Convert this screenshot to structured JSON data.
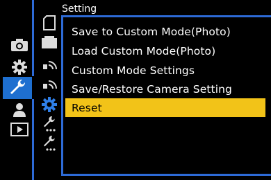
{
  "header": {
    "title": "Setting"
  },
  "main_tabs": [
    {
      "icon": "camera-icon",
      "label": "Photo"
    },
    {
      "icon": "gear-icon",
      "label": "Custom"
    },
    {
      "icon": "wrench-icon",
      "label": "Setup"
    },
    {
      "icon": "person-icon",
      "label": "My Menu"
    },
    {
      "icon": "playback-icon",
      "label": "Playback"
    }
  ],
  "sub_tabs": [
    {
      "icon": "card-icon"
    },
    {
      "icon": "monitor-icon"
    },
    {
      "icon": "wireless-icon"
    },
    {
      "icon": "wireless-icon"
    },
    {
      "icon": "gear-icon"
    },
    {
      "icon": "wrench-dots-icon"
    },
    {
      "icon": "wrench-dots-icon"
    }
  ],
  "menu": {
    "items": [
      {
        "label": "Save to Custom Mode(Photo)"
      },
      {
        "label": "Load Custom Mode(Photo)"
      },
      {
        "label": "Custom Mode Settings"
      },
      {
        "label": "Save/Restore Camera Setting"
      },
      {
        "label": "Reset"
      }
    ],
    "selected_index": 4
  },
  "colors": {
    "accent": "#2d6ad6",
    "highlight": "#f2c318",
    "background": "#000000"
  }
}
